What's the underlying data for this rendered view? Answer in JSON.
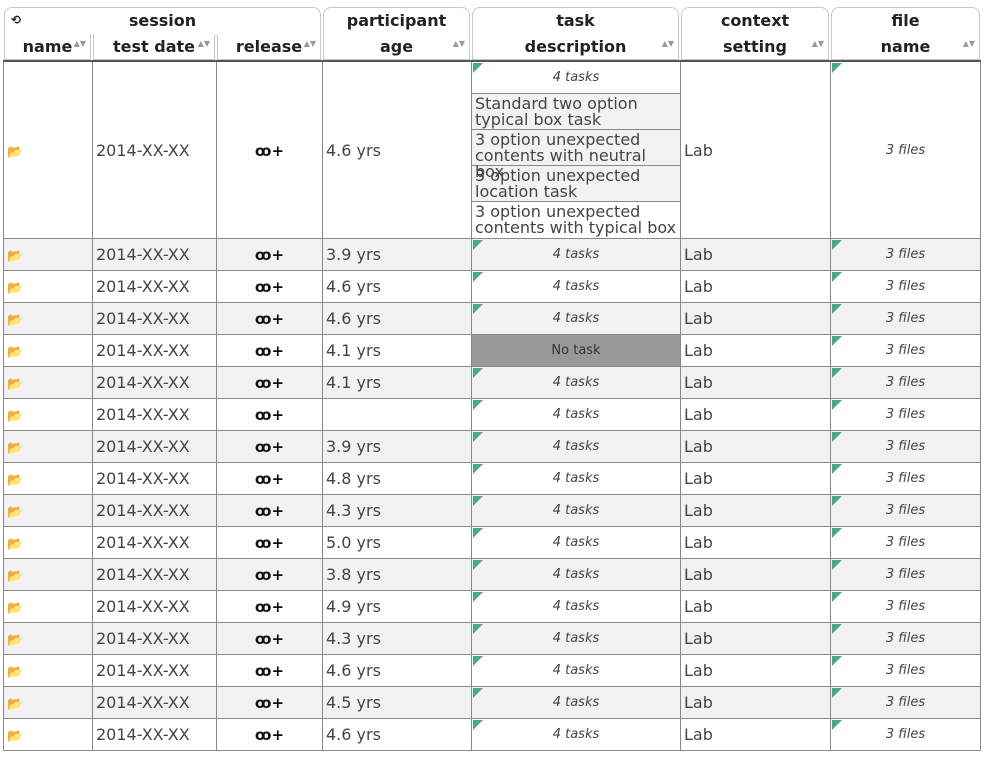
{
  "header": {
    "group_session": "session",
    "participant_line1": "participant",
    "participant_line2": "age",
    "task_line1": "task",
    "task_line2": "description",
    "context_line1": "context",
    "context_line2": "setting",
    "file_line1": "file",
    "file_line2": "name",
    "col_name": "name",
    "col_date": "test date",
    "col_release": "release",
    "reset_icon": "reset-sort-icon",
    "sort_icon": "sort-arrows-icon"
  },
  "expanded_row": {
    "date": "2014-XX-XX",
    "age": "4.6 yrs",
    "task_summary": "4 tasks",
    "tasks": [
      "Standard two option typical box task",
      "3 option unexpected contents with neutral box",
      "3 option unexpected location task",
      "3 option unexpected contents with typical box"
    ],
    "context": "Lab",
    "files": "3 files"
  },
  "rows": [
    {
      "date": "2014-XX-XX",
      "age": "3.9 yrs",
      "tasks": "4 tasks",
      "context": "Lab",
      "files": "3 files"
    },
    {
      "date": "2014-XX-XX",
      "age": "4.6 yrs",
      "tasks": "4 tasks",
      "context": "Lab",
      "files": "3 files"
    },
    {
      "date": "2014-XX-XX",
      "age": "4.6 yrs",
      "tasks": "4 tasks",
      "context": "Lab",
      "files": "3 files"
    },
    {
      "date": "2014-XX-XX",
      "age": "4.1 yrs",
      "tasks": "No task",
      "context": "Lab",
      "files": "3 files",
      "no_task": true
    },
    {
      "date": "2014-XX-XX",
      "age": "4.1 yrs",
      "tasks": "4 tasks",
      "context": "Lab",
      "files": "3 files"
    },
    {
      "date": "2014-XX-XX",
      "age": "",
      "tasks": "4 tasks",
      "context": "Lab",
      "files": "3 files"
    },
    {
      "date": "2014-XX-XX",
      "age": "3.9 yrs",
      "tasks": "4 tasks",
      "context": "Lab",
      "files": "3 files"
    },
    {
      "date": "2014-XX-XX",
      "age": "4.8 yrs",
      "tasks": "4 tasks",
      "context": "Lab",
      "files": "3 files"
    },
    {
      "date": "2014-XX-XX",
      "age": "4.3 yrs",
      "tasks": "4 tasks",
      "context": "Lab",
      "files": "3 files"
    },
    {
      "date": "2014-XX-XX",
      "age": "5.0 yrs",
      "tasks": "4 tasks",
      "context": "Lab",
      "files": "3 files"
    },
    {
      "date": "2014-XX-XX",
      "age": "3.8 yrs",
      "tasks": "4 tasks",
      "context": "Lab",
      "files": "3 files"
    },
    {
      "date": "2014-XX-XX",
      "age": "4.9 yrs",
      "tasks": "4 tasks",
      "context": "Lab",
      "files": "3 files"
    },
    {
      "date": "2014-XX-XX",
      "age": "4.3 yrs",
      "tasks": "4 tasks",
      "context": "Lab",
      "files": "3 files"
    },
    {
      "date": "2014-XX-XX",
      "age": "4.6 yrs",
      "tasks": "4 tasks",
      "context": "Lab",
      "files": "3 files"
    },
    {
      "date": "2014-XX-XX",
      "age": "4.5 yrs",
      "tasks": "4 tasks",
      "context": "Lab",
      "files": "3 files"
    },
    {
      "date": "2014-XX-XX",
      "age": "4.6 yrs",
      "tasks": "4 tasks",
      "context": "Lab",
      "files": "3 files"
    }
  ],
  "icons": {
    "folder": "folder-open-icon",
    "release": "release-shared-icon",
    "corner": "expand-corner-icon"
  },
  "colors": {
    "corner_marker": "#4aa88a",
    "no_task_bg": "#999999",
    "alt_row_bg": "#f2f2f2"
  }
}
